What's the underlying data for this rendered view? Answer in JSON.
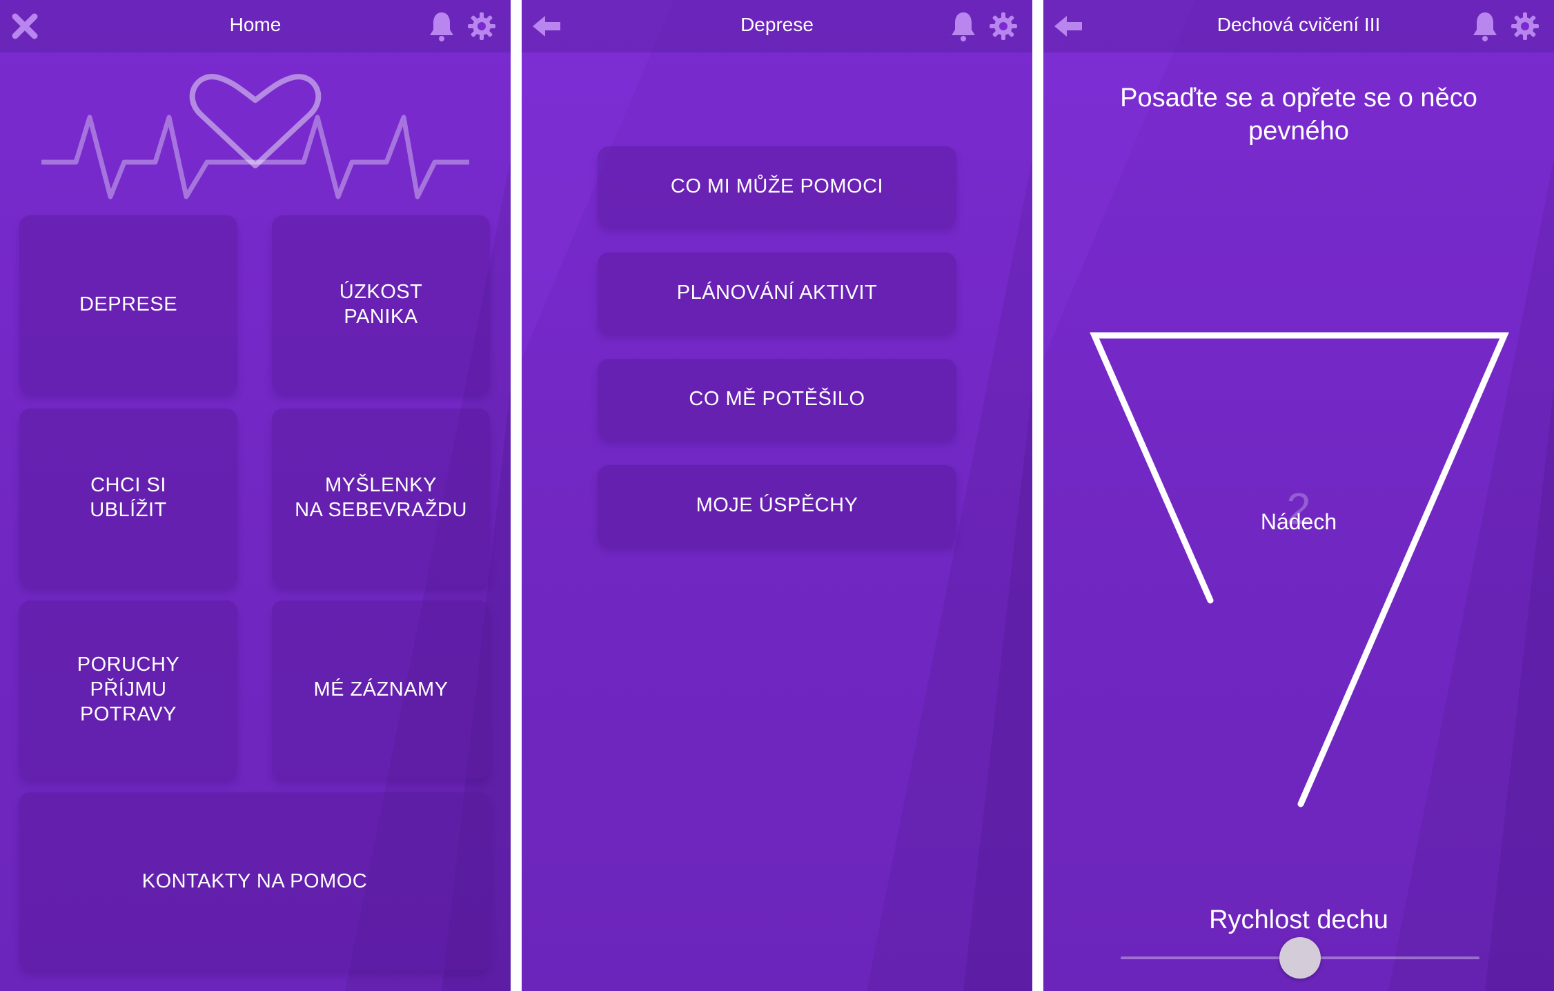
{
  "colors": {
    "background": "#7a2bcf",
    "tile": "#5a1a96",
    "text": "#ffffff",
    "icon": "#b985ee"
  },
  "home": {
    "title": "Home",
    "left_icon": "close-icon",
    "tiles": [
      {
        "label": "DEPRESE"
      },
      {
        "label": "ÚZKOST\nPANIKA"
      },
      {
        "label": "CHCI SI\nUBLÍŽIT"
      },
      {
        "label": "MYŠLENKY\nNA SEBEVRAŽDU"
      },
      {
        "label": "PORUCHY\nPŘÍJMU\nPOTRAVY"
      },
      {
        "label": "MÉ ZÁZNAMY"
      },
      {
        "label": "KONTAKTY NA POMOC"
      }
    ]
  },
  "deprese": {
    "title": "Deprese",
    "left_icon": "back-arrow-icon",
    "items": [
      {
        "label": "CO MI MŮŽE POMOCI"
      },
      {
        "label": "PLÁNOVÁNÍ AKTIVIT"
      },
      {
        "label": "CO MĚ POTĚŠILO"
      },
      {
        "label": "MOJE ÚSPĚCHY"
      }
    ]
  },
  "breathing": {
    "title": "Dechová cvičení III",
    "left_icon": "back-arrow-icon",
    "instruction": "Posaďte se a opřete se o něco pevného",
    "counter": "2",
    "phase": "Nádech",
    "speed_label": "Rychlost dechu",
    "speed_value": 0.5
  }
}
